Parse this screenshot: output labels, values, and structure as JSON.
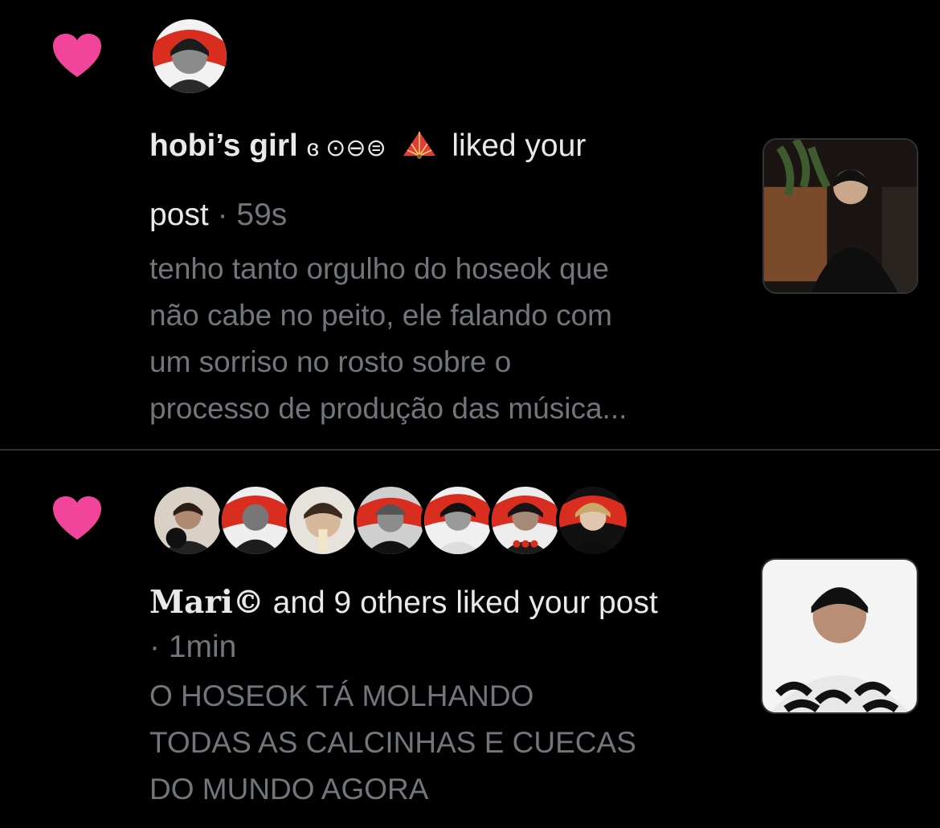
{
  "notifications": [
    {
      "icon": "heart-icon",
      "accent_color": "#f0459b",
      "name": "hobi’s girl",
      "name_decor": "ɞ ⊙⊖⊜",
      "action_text": "liked your",
      "action_text_2": "post",
      "separator": "·",
      "time": "59s",
      "preview_lines": [
        "tenho tanto orgulho do hoseok que",
        "não cabe no peito, ele falando com",
        "um sorriso no rosto sobre o",
        "processo de produção das música..."
      ]
    },
    {
      "icon": "heart-icon",
      "accent_color": "#f0459b",
      "name": "Mari©",
      "action_text": "and 9 others liked your post",
      "time_line": "· 1min",
      "preview_lines": [
        "O HOSEOK TÁ MOLHANDO",
        "TODAS AS CALCINHAS E CUECAS",
        "DO MUNDO AGORA"
      ]
    }
  ]
}
